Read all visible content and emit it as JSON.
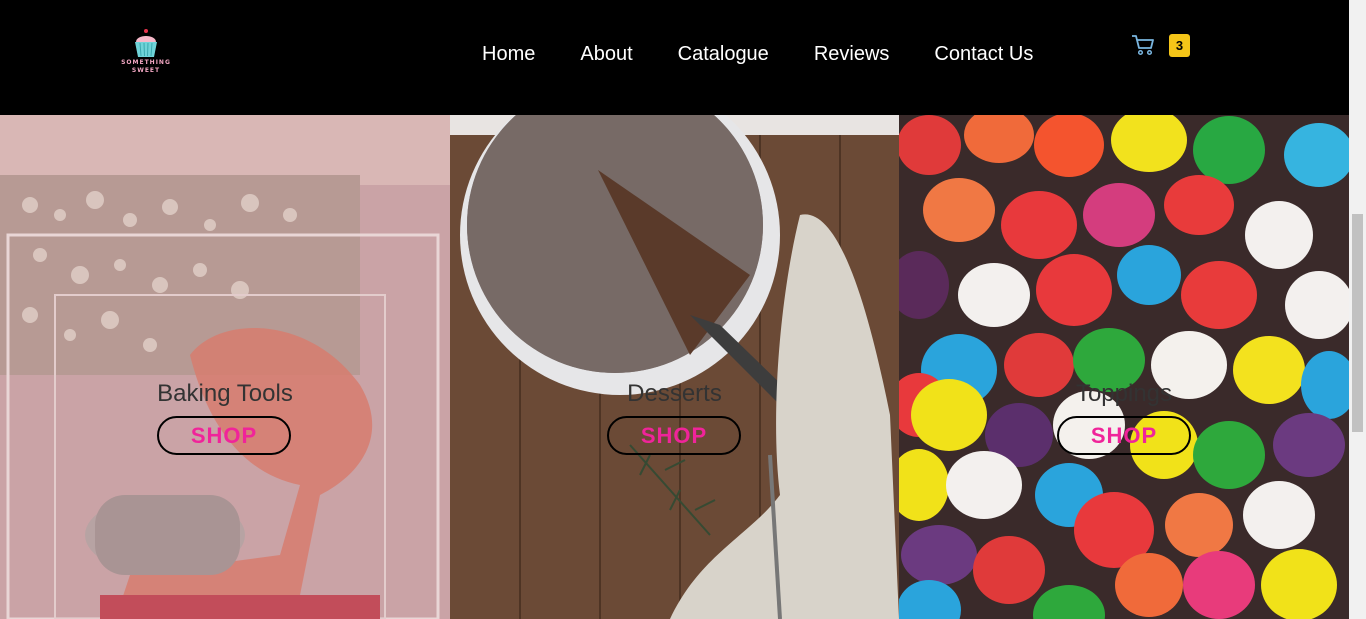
{
  "brand": {
    "logo_text_line1": "SOMETHING",
    "logo_text_line2": "SWEET"
  },
  "nav": {
    "items": [
      "Home",
      "About",
      "Catalogue",
      "Reviews",
      "Contact Us"
    ]
  },
  "cart": {
    "icon": "cart-icon",
    "count": "3"
  },
  "categories": [
    {
      "title": "Baking Tools",
      "button": "SHOP"
    },
    {
      "title": "Desserts",
      "button": "SHOP"
    },
    {
      "title": "Toppings",
      "button": "SHOP"
    }
  ],
  "colors": {
    "header_bg": "#000000",
    "accent_pink": "#f0249a",
    "badge_yellow": "#f5c518",
    "cart_blue": "#7ab6e0"
  }
}
